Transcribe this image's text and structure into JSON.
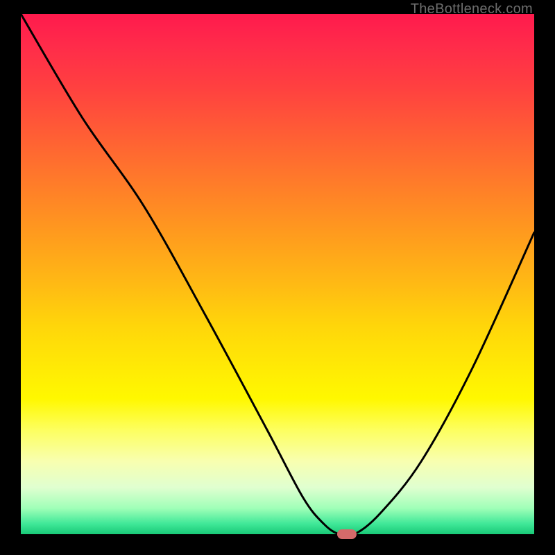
{
  "watermark": "TheBottleneck.com",
  "chart_data": {
    "type": "line",
    "title": "",
    "xlabel": "",
    "ylabel": "",
    "x_range": [
      0,
      100
    ],
    "y_range": [
      0,
      100
    ],
    "series": [
      {
        "name": "bottleneck-curve",
        "x": [
          0,
          12,
          24,
          36,
          48,
          55,
          59,
          62,
          65,
          70,
          78,
          88,
          100
        ],
        "values": [
          100,
          80,
          63,
          42,
          20,
          7,
          2,
          0,
          0,
          4,
          14,
          32,
          58
        ]
      }
    ],
    "optimum_marker": {
      "x": 63.5,
      "y": 0
    },
    "gradient_scale": {
      "description": "vertical bottleneck severity, 0=green (good) to 100=red (bad)",
      "stops": [
        {
          "pct": 0,
          "color": "#18c977"
        },
        {
          "pct": 5,
          "color": "#a0ffb8"
        },
        {
          "pct": 14,
          "color": "#f8ffb0"
        },
        {
          "pct": 26,
          "color": "#fff800"
        },
        {
          "pct": 40,
          "color": "#ffd60a"
        },
        {
          "pct": 58,
          "color": "#ff9a1e"
        },
        {
          "pct": 78,
          "color": "#ff5a36"
        },
        {
          "pct": 100,
          "color": "#ff1a4d"
        }
      ]
    }
  }
}
